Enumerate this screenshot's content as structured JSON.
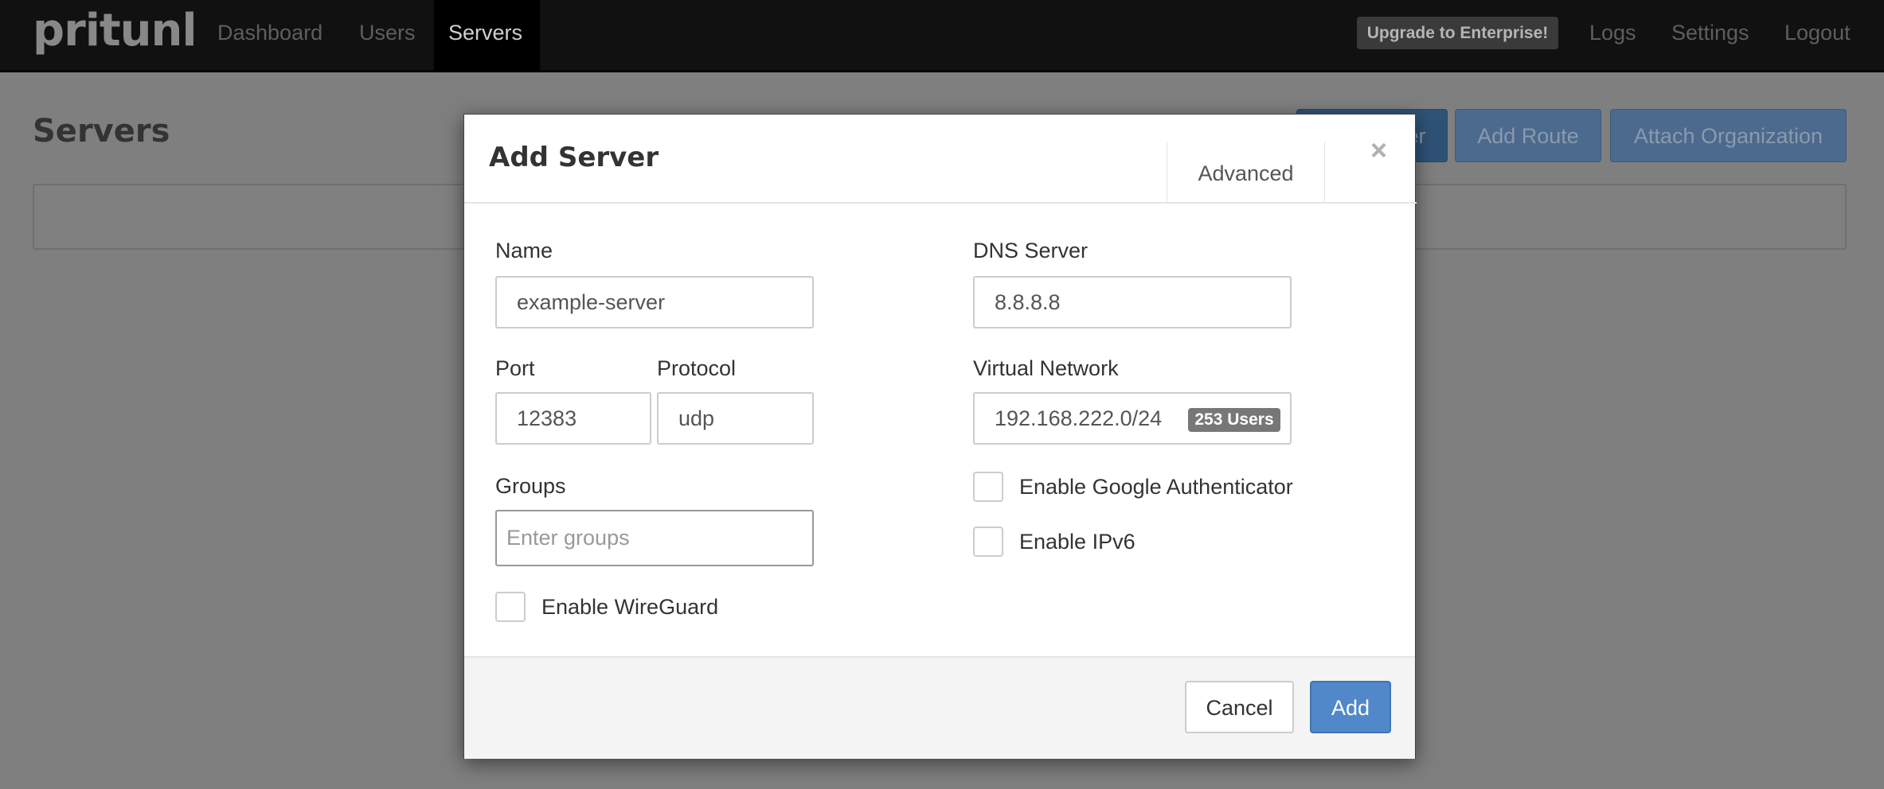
{
  "navbar": {
    "logo": "pritunl",
    "items": [
      {
        "label": "Dashboard"
      },
      {
        "label": "Users"
      },
      {
        "label": "Servers",
        "active": true
      }
    ],
    "upgrade": "Upgrade to Enterprise!",
    "right_items": [
      {
        "label": "Logs"
      },
      {
        "label": "Settings"
      },
      {
        "label": "Logout"
      }
    ]
  },
  "page": {
    "title": "Servers",
    "buttons": {
      "add_server": "Add Server",
      "add_route": "Add Route",
      "attach_org": "Attach Organization"
    }
  },
  "modal": {
    "title": "Add Server",
    "advanced": "Advanced",
    "close": "×",
    "name": {
      "label": "Name",
      "value": "example-server"
    },
    "port": {
      "label": "Port",
      "value": "12383"
    },
    "protocol": {
      "label": "Protocol",
      "value": "udp"
    },
    "groups": {
      "label": "Groups",
      "placeholder": "Enter groups"
    },
    "wireguard": {
      "label": "Enable WireGuard",
      "checked": false
    },
    "dns": {
      "label": "DNS Server",
      "value": "8.8.8.8"
    },
    "network": {
      "label": "Virtual Network",
      "value": "192.168.222.0/24",
      "badge": "253 Users"
    },
    "google_auth": {
      "label": "Enable Google Authenticator",
      "checked": false
    },
    "ipv6": {
      "label": "Enable IPv6",
      "checked": false
    },
    "cancel": "Cancel",
    "add": "Add"
  },
  "colors": {
    "primary": "#5088c9",
    "navbar": "#111111"
  }
}
